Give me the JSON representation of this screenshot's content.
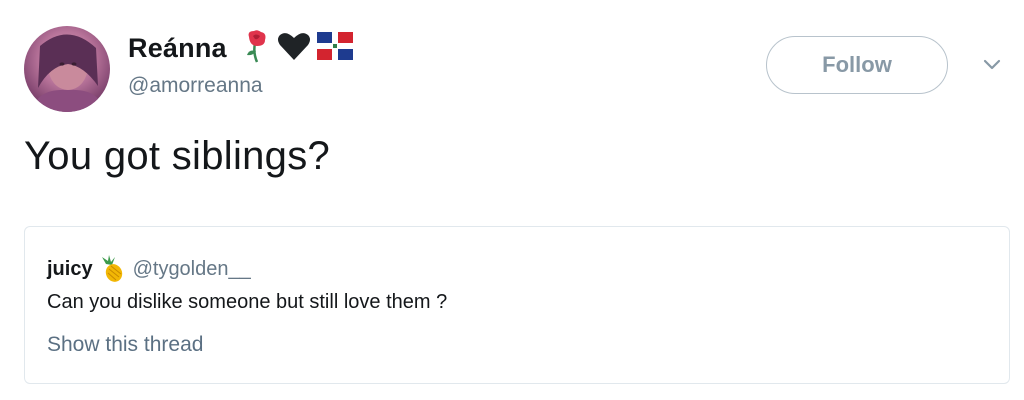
{
  "author": {
    "display_name": "Reánna",
    "handle": "@amorreanna",
    "name_emoji": [
      "rose-icon",
      "black-heart-icon",
      "dominican-flag-icon"
    ],
    "avatar": "avatar"
  },
  "follow": {
    "label": "Follow"
  },
  "menu": {
    "icon": "chevron-down-icon"
  },
  "tweet": {
    "text": "You got siblings?"
  },
  "quoted": {
    "display_name": "juicy",
    "emoji": "pineapple-icon",
    "handle": "@tygolden__",
    "text": "Can you dislike someone but still love them ?",
    "show_thread": "Show this thread"
  },
  "colors": {
    "text_primary": "#14171a",
    "text_secondary": "#657786",
    "border": "#e1e8ed",
    "follow_border": "#b8c3cc",
    "follow_text": "#8899a6"
  }
}
